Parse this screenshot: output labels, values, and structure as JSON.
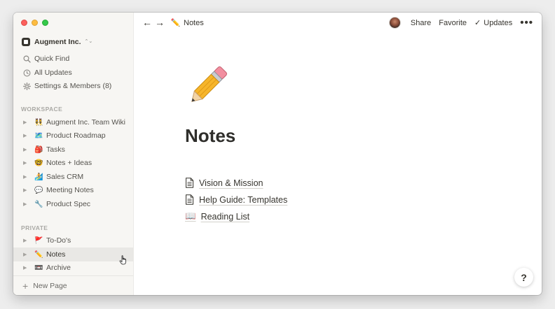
{
  "sidebar": {
    "workspace_name": "Augment Inc.",
    "workspace_switch_glyph": "⌃⌄",
    "nav": [
      {
        "label": "Quick Find",
        "icon": "search-icon"
      },
      {
        "label": "All Updates",
        "icon": "clock-icon"
      },
      {
        "label": "Settings & Members (8)",
        "icon": "gear-icon"
      }
    ],
    "workspace_label": "WORKSPACE",
    "workspace_pages": [
      {
        "emoji": "👯",
        "label": "Augment Inc. Team Wiki"
      },
      {
        "emoji": "🗺️",
        "label": "Product Roadmap"
      },
      {
        "emoji": "🎒",
        "label": "Tasks"
      },
      {
        "emoji": "🤓",
        "label": "Notes + Ideas"
      },
      {
        "emoji": "🏄",
        "label": "Sales CRM"
      },
      {
        "emoji": "💬",
        "label": "Meeting Notes"
      },
      {
        "emoji": "🔧",
        "label": "Product Spec"
      }
    ],
    "private_label": "PRIVATE",
    "private_pages": [
      {
        "emoji": "🚩",
        "label": "To-Do's"
      },
      {
        "emoji": "✏️",
        "label": "Notes"
      },
      {
        "emoji": "📼",
        "label": "Archive"
      }
    ],
    "active_page": "Notes",
    "new_page_label": "New Page",
    "new_page_glyph": "+"
  },
  "topbar": {
    "back_glyph": "←",
    "forward_glyph": "→",
    "breadcrumb_emoji": "✏️",
    "breadcrumb_label": "Notes",
    "share_label": "Share",
    "favorite_label": "Favorite",
    "updates_check": "✓",
    "updates_label": "Updates",
    "more_glyph": "•••"
  },
  "page": {
    "icon": "pencil-icon",
    "title": "Notes",
    "children": [
      {
        "label": "Vision & Mission",
        "icon": "document-icon"
      },
      {
        "label": "Help Guide: Templates",
        "icon": "document-icon"
      },
      {
        "label": "Reading List",
        "icon": "open-book-icon",
        "emoji": "📖"
      }
    ]
  },
  "help_label": "?",
  "colors": {
    "sidebar_bg": "#f7f6f3",
    "active_row": "#e9e8e5",
    "text": "#37352f",
    "traffic_red": "#fc605c",
    "traffic_yellow": "#fdbc40",
    "traffic_green": "#34c84a"
  }
}
